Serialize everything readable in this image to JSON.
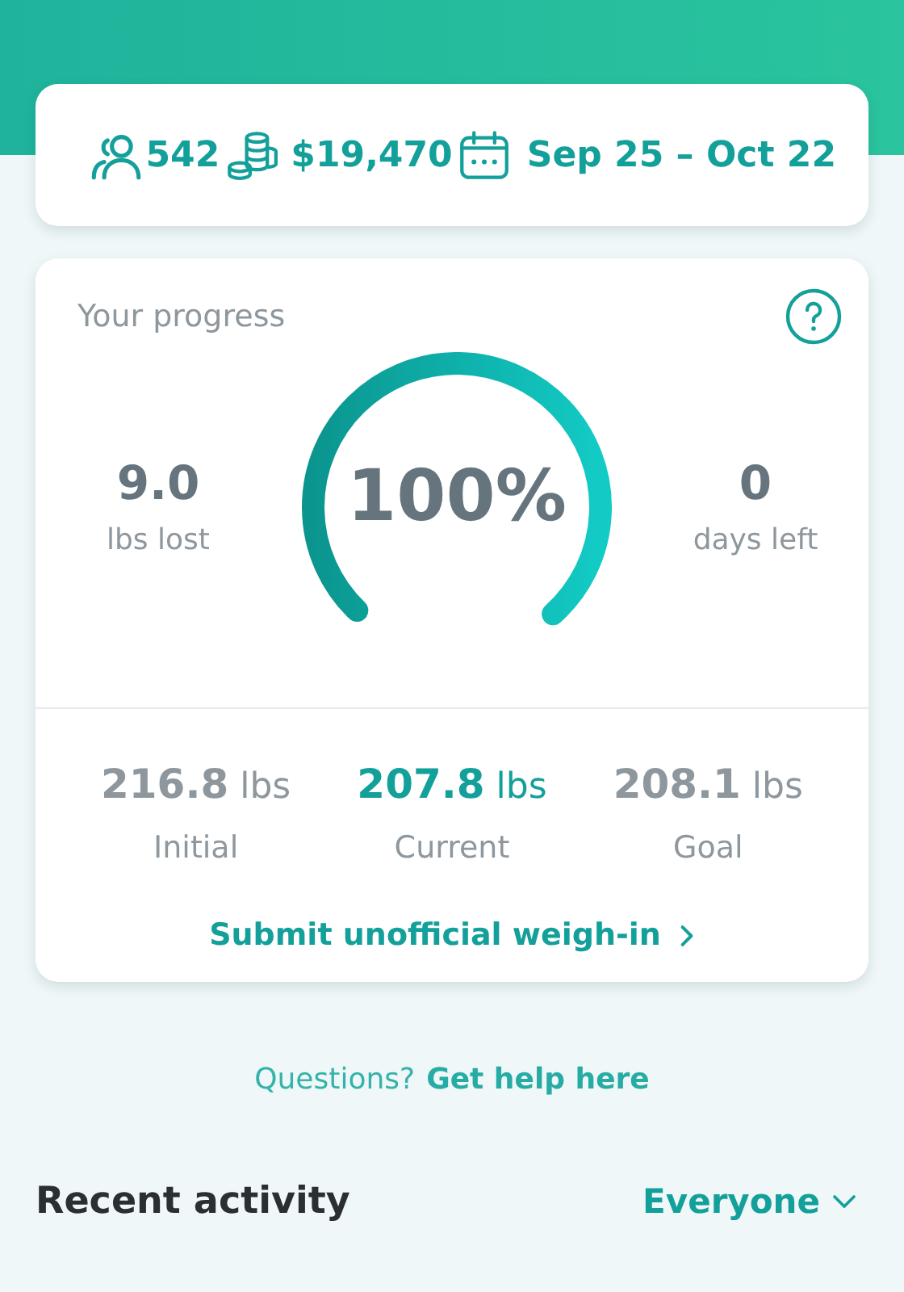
{
  "summary": {
    "participants": "542",
    "pot": "$19,470",
    "dates": "Sep 25 – Oct 22"
  },
  "progress": {
    "title": "Your progress",
    "gauge": {
      "label": "100%"
    },
    "left": {
      "value": "9.0",
      "label": "lbs lost"
    },
    "right": {
      "value": "0",
      "label": "days left"
    },
    "weights": [
      {
        "value": "**216.8** lbs",
        "label": "Initial",
        "selected": false
      },
      {
        "value": "**207.8** lbs",
        "label": "Current",
        "selected": true
      },
      {
        "value": "**208.1** lbs",
        "label": "Goal",
        "selected": false
      }
    ],
    "action": "Submit unofficial weigh-in"
  },
  "help": {
    "text": "Questions?",
    "link": "Get help here"
  },
  "activity": {
    "title": "Recent activity",
    "filter": "Everyone"
  }
}
